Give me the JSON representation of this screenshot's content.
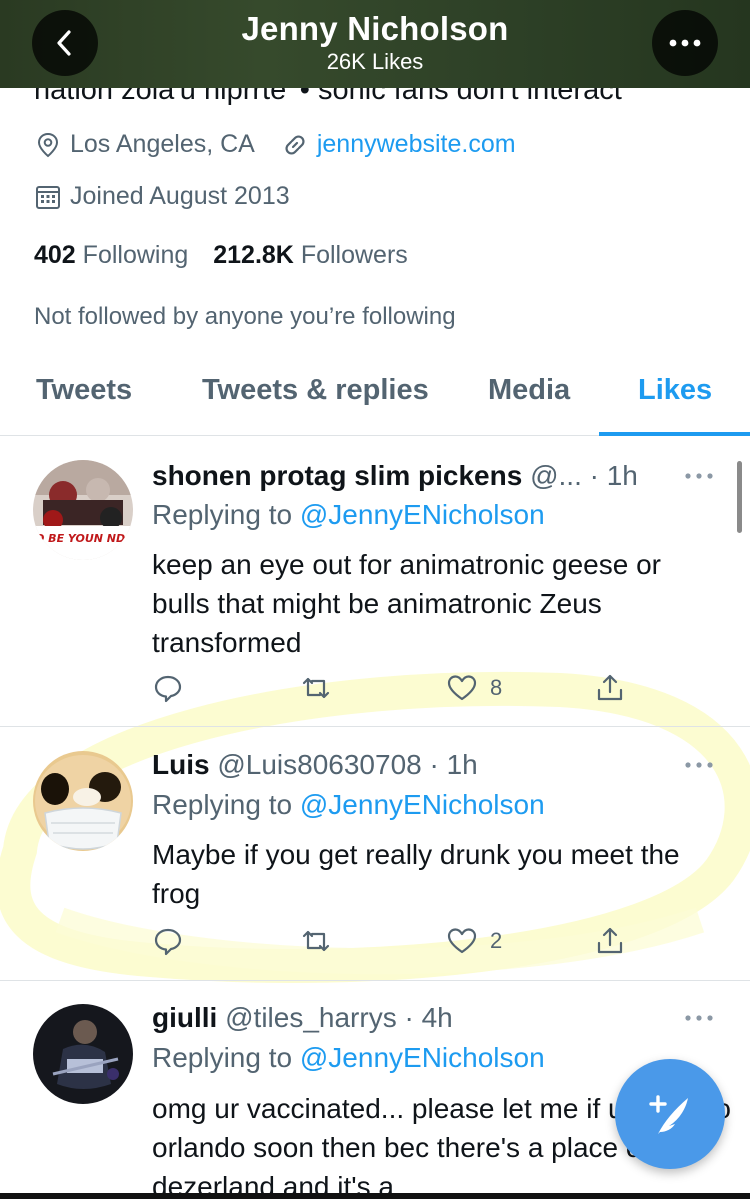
{
  "header": {
    "title": "Jenny Nicholson",
    "subtitle": "26K Likes"
  },
  "profile": {
    "bio_partial": "nation zola'u niprrte' • sonic fans don't interact",
    "location": "Los Angeles, CA",
    "website": "jennywebsite.com",
    "joined": "Joined August 2013",
    "following_count": "402",
    "following_label": "Following",
    "followers_count": "212.8K",
    "followers_label": "Followers",
    "not_followed_text": "Not followed by anyone you’re following"
  },
  "tabs": [
    {
      "label": "Tweets"
    },
    {
      "label": "Tweets & replies"
    },
    {
      "label": "Media"
    },
    {
      "label": "Likes"
    }
  ],
  "active_tab": "Likes",
  "tweets": [
    {
      "name": "shonen protag slim pickens",
      "handle_time": "@... · 1h",
      "reply_label": "Replying to",
      "reply_to": "@JennyENicholson",
      "body": "keep an eye out for animatronic geese or bulls that might be animatronic Zeus transformed",
      "like_count": "8",
      "avatar_text": "O BE YOUN ND ONL"
    },
    {
      "name": "Luis",
      "handle_time": "@Luis80630708 · 1h",
      "reply_label": "Replying to",
      "reply_to": "@JennyENicholson",
      "body": "Maybe if you get really drunk you meet the frog",
      "like_count": "2"
    },
    {
      "name": "giulli",
      "handle_time": "@tiles_harrys · 4h",
      "reply_label": "Replying to",
      "reply_to": "@JennyENicholson",
      "body": "omg ur vaccinated... please let me if u come to orlando soon then bec there's a place called dezerland and it's a"
    }
  ],
  "colors": {
    "accent": "#1d9bf0",
    "header_bg": "#2e4127",
    "fab": "#4a99e9",
    "highlight": "#fbfbc9"
  },
  "icons": {
    "back": "chevron-left-icon",
    "more": "more-icon",
    "location": "location-pin-icon",
    "link": "link-icon",
    "calendar": "calendar-icon",
    "reply": "reply-icon",
    "retweet": "retweet-icon",
    "like": "heart-icon",
    "share": "share-icon",
    "compose": "compose-icon"
  }
}
